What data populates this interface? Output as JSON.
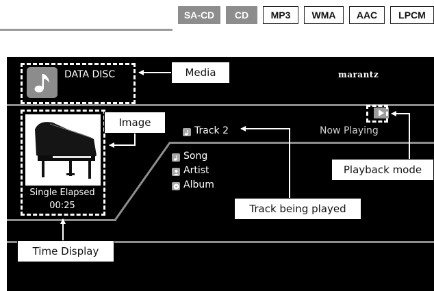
{
  "format_badges": [
    {
      "label": "SA-CD",
      "style": "filled"
    },
    {
      "label": "CD",
      "style": "filled"
    },
    {
      "label": "MP3",
      "style": "outlined"
    },
    {
      "label": "WMA",
      "style": "outlined"
    },
    {
      "label": "AAC",
      "style": "outlined"
    },
    {
      "label": "LPCM",
      "style": "outlined"
    }
  ],
  "screen": {
    "media_label": "DATA DISC",
    "media_icon": "music-note-icon",
    "brand": "marantz",
    "elapsed_label": "Single Elapsed",
    "elapsed_time": "00:25",
    "track_label": "Track 2",
    "track_icon": "music-file-icon",
    "info_items": [
      {
        "label": "Song",
        "icon": "music-note-icon"
      },
      {
        "label": "Artist",
        "icon": "person-icon"
      },
      {
        "label": "Album",
        "icon": "disc-icon"
      }
    ],
    "status_text": "Now Playing",
    "playback_mode_icon": "play-icon"
  },
  "callouts": {
    "media": "Media",
    "image": "Image",
    "track": "Track being played",
    "playback_mode": "Playback mode",
    "time_display": "Time Display"
  },
  "colors": {
    "screen_background": "#000000",
    "badge_filled": "#8d8d8d",
    "divider": "#8e8e8e",
    "annotation": "#ffffff"
  }
}
